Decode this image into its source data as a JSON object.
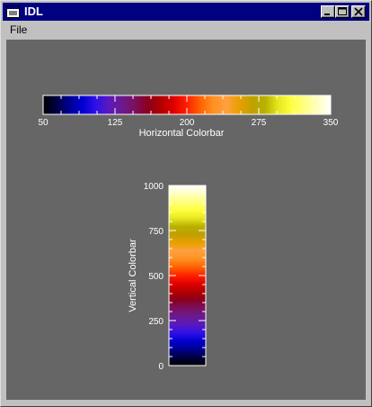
{
  "window": {
    "title": "IDL",
    "titlebar_color": "#000080",
    "icon": "idl-window-icon",
    "buttons": [
      "minimize-icon",
      "maximize-icon",
      "close-icon"
    ]
  },
  "menu": {
    "items": [
      {
        "label": "File"
      }
    ]
  },
  "canvas": {
    "background": "#666666"
  },
  "chart_data": [
    {
      "type": "colorbar",
      "orientation": "horizontal",
      "title": "Horizontal Colorbar",
      "range": [
        50,
        350
      ],
      "tick_labels": [
        "50",
        "125",
        "200",
        "275",
        "350"
      ],
      "minor_ticks_per_interval": 4
    },
    {
      "type": "colorbar",
      "orientation": "vertical",
      "title": "Vertical Colorbar",
      "range": [
        0,
        1000
      ],
      "tick_labels": [
        "0",
        "250",
        "500",
        "750",
        "1000"
      ],
      "minor_ticks_per_interval": 5
    }
  ],
  "colormap": {
    "name": "color-table",
    "stops": [
      "#000000",
      "#000040",
      "#000090",
      "#0000d0",
      "#3010e8",
      "#5a18c0",
      "#6a1a90",
      "#7a1060",
      "#8a0020",
      "#b00000",
      "#e00000",
      "#ff2000",
      "#ff6000",
      "#ff9020",
      "#ffa040",
      "#e8a000",
      "#c0a000",
      "#b8b000",
      "#e8e820",
      "#ffff40",
      "#ffff80",
      "#ffffc0",
      "#ffffff"
    ]
  }
}
